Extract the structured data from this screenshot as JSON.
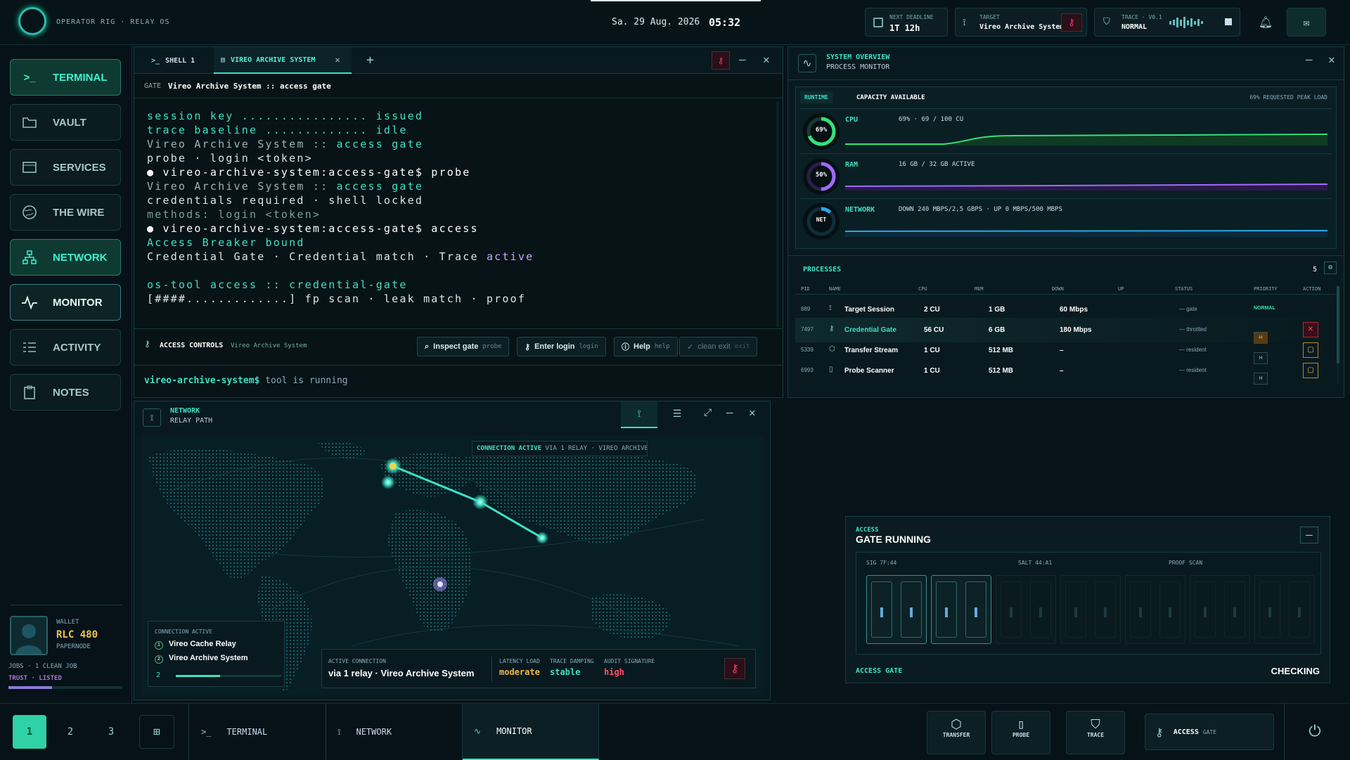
{
  "top": {
    "brand": "OPERATOR RIG · RELAY OS",
    "date": "Sa. 29 Aug. 2026",
    "time": "05:32",
    "deadline_label": "NEXT DEADLINE",
    "deadline_value": "1T 12h",
    "target_label": "TARGET",
    "target_value": "Vireo Archive System",
    "trace_label": "TRACE · V0.1",
    "trace_value": "NORMAL"
  },
  "sidebar": {
    "items": [
      {
        "label": "TERMINAL",
        "icon": "terminal-icon"
      },
      {
        "label": "VAULT",
        "icon": "folder-icon"
      },
      {
        "label": "SERVICES",
        "icon": "browser-icon"
      },
      {
        "label": "THE WIRE",
        "icon": "globe-icon"
      },
      {
        "label": "NETWORK",
        "icon": "network-icon"
      },
      {
        "label": "MONITOR",
        "icon": "pulse-icon"
      },
      {
        "label": "ACTIVITY",
        "icon": "list-icon"
      },
      {
        "label": "NOTES",
        "icon": "clipboard-icon"
      }
    ],
    "wallet_label": "WALLET",
    "wallet_value": "RLC 480",
    "wallet_sub": "PAPERNODE",
    "jobs": "JOBS · 1 CLEAN JOB",
    "trust": "TRUST · LISTED",
    "trust_level": 0.38
  },
  "terminal": {
    "tab1": "SHELL 1",
    "tab2": "VIREO ARCHIVE SYSTEM",
    "gate_label": "GATE",
    "gate_value": "Vireo Archive System :: access gate",
    "lines": [
      {
        "a": "session key ................ ",
        "b": "issued",
        "ca": "#3fe0c4",
        "cb": "#3fe0c4"
      },
      {
        "a": "trace baseline ............. ",
        "b": "idle",
        "ca": "#3fe0c4",
        "cb": "#3fe0c4"
      },
      {
        "a": "Vireo Archive System :: ",
        "b": "access gate",
        "ca": "#9ab4b4",
        "cb": "#3fe0c4"
      },
      {
        "a": "probe · login <token>",
        "b": "",
        "ca": "#d5e8e6",
        "cb": "#d5e8e6"
      },
      {
        "a": "● vireo-archive-system:access-gate$ probe",
        "b": "",
        "ca": "#ffffff",
        "cb": "#ffffff"
      },
      {
        "a": "Vireo Archive System :: ",
        "b": "access gate",
        "ca": "#9ab4b4",
        "cb": "#3fe0c4"
      },
      {
        "a": "credentials required · shell locked",
        "b": "",
        "ca": "#d5e8e6",
        "cb": "#d5e8e6"
      },
      {
        "a": "methods: login <token>",
        "b": "",
        "ca": "#7a9e9c",
        "cb": "#7a9e9c"
      },
      {
        "a": "● vireo-archive-system:access-gate$ access",
        "b": "",
        "ca": "#ffffff",
        "cb": "#ffffff"
      },
      {
        "a": "Access Breaker bound",
        "b": "",
        "ca": "#3fe0c4",
        "cb": "#3fe0c4"
      },
      {
        "a": "Credential Gate · Credential match · Trace ",
        "b": "active",
        "ca": "#d5e8e6",
        "cb": "#c9a6ff"
      },
      {
        "a": "",
        "b": "",
        "ca": "#d5e8e6",
        "cb": "#d5e8e6"
      },
      {
        "a": "os-tool access :: credential-gate",
        "b": "",
        "ca": "#3fe0c4",
        "cb": "#3fe0c4"
      },
      {
        "a": "[####.............] fp scan · leak match · proof",
        "b": "",
        "ca": "#d5e8e6",
        "cb": "#d5e8e6"
      }
    ],
    "controls_label": "ACCESS CONTROLS",
    "controls_target": "Vireo Archive System",
    "btn_inspect": "Inspect gate",
    "btn_inspect_sub": "probe",
    "btn_login": "Enter login",
    "btn_login_sub": "login",
    "btn_help": "Help",
    "btn_help_sub": "help",
    "btn_exit": "clean exit",
    "btn_exit_sub": "exit",
    "prompt": "vireo-archive-system$",
    "prompt_msg": "tool is running"
  },
  "network": {
    "title": "NETWORK",
    "subtitle": "RELAY PATH",
    "status_active": "CONNECTION ACTIVE",
    "status_via": "VIA 1 RELAY · VIREO ARCHIVE…",
    "conn_label": "CONNECTION ACTIVE",
    "hop1": "Vireo Cache Relay",
    "hop2": "Vireo Archive System",
    "hop_count": "2",
    "active_label": "ACTIVE CONNECTION",
    "active_value": "via 1 relay · Vireo Archive System",
    "latency_label": "LATENCY LOAD",
    "latency_value": "moderate",
    "damping_label": "TRACE DAMPING",
    "damping_value": "stable",
    "audit_label": "AUDIT SIGNATURE",
    "audit_value": "high"
  },
  "overview": {
    "title": "SYSTEM OVERVIEW",
    "subtitle": "PROCESS MONITOR",
    "runtime": "RUNTIME",
    "capacity": "CAPACITY AVAILABLE",
    "peak": "69% REQUESTED PEAK LOAD",
    "cpu_ring": "69%",
    "cpu_label": "CPU",
    "cpu_value": "69% · 69 / 100 CU",
    "cpu_pct": 69,
    "ram_ring": "50%",
    "ram_label": "RAM",
    "ram_value": "16 GB / 32 GB ACTIVE",
    "ram_pct": 50,
    "net_ring": "NET",
    "net_label": "NETWORK",
    "net_value": "DOWN 240 MBPS/2,5 GBPS · UP 0 MBPS/500 MBPS",
    "proc_title": "PROCESSES",
    "proc_count": "5",
    "cols": [
      "PID",
      "NAME",
      "CPU",
      "MEM",
      "DOWN",
      "UP",
      "STATUS",
      "PRIORITY",
      "ACTION"
    ],
    "rows": [
      {
        "pid": "889",
        "name": "Target Session",
        "cpu": "2 CU",
        "mem": "1 GB",
        "down": "60 Mbps",
        "up": "",
        "status": "— gate",
        "prio": "NORMAL"
      },
      {
        "pid": "7497",
        "name": "Credential Gate",
        "cpu": "56 CU",
        "mem": "6 GB",
        "down": "180 Mbps",
        "up": "",
        "status": "— throttled",
        "prio": "LNH"
      },
      {
        "pid": "5339",
        "name": "Transfer Stream",
        "cpu": "1 CU",
        "mem": "512 MB",
        "down": "–",
        "up": "",
        "status": "— resident",
        "prio": "LNH"
      },
      {
        "pid": "6993",
        "name": "Probe Scanner",
        "cpu": "1 CU",
        "mem": "512 MB",
        "down": "–",
        "up": "",
        "status": "— resident",
        "prio": "LNH"
      }
    ],
    "prio_l": "L",
    "prio_n": "N",
    "prio_h": "H"
  },
  "access": {
    "label": "ACCESS",
    "title": "GATE RUNNING",
    "sig": "SIG 7F:44",
    "salt": "SALT 44:A1",
    "proof": "PROOF SCAN",
    "footer_label": "ACCESS GATE",
    "footer_status": "CHECKING"
  },
  "bottom": {
    "ws1": "1",
    "ws2": "2",
    "ws3": "3",
    "task1": "TERMINAL",
    "task2": "NETWORK",
    "task3": "MONITOR",
    "tool1": "TRANSFER",
    "tool2": "PROBE",
    "tool3": "TRACE",
    "access_label": "ACCESS",
    "access_sub": "GATE"
  }
}
